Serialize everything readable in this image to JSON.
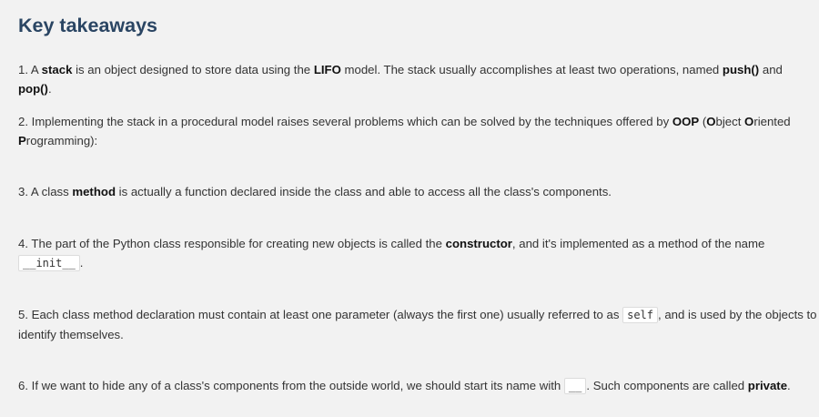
{
  "title": "Key takeaways",
  "items": [
    {
      "num": "1. A ",
      "b1": "stack",
      "t1": " is an object designed to store data using the ",
      "b2": "LIFO",
      "t2": " model. The stack usually accomplishes at least two operations, named ",
      "b3": "push()",
      "t3": " and ",
      "b4": "pop()",
      "t4": "."
    },
    {
      "t1": "2. Implementing the stack in a procedural model raises several problems which can be solved by the techniques offered by ",
      "b1": "OOP",
      "t2": " (",
      "b2": "O",
      "t3": "bject ",
      "b3": "O",
      "t4": "riented ",
      "b4": "P",
      "t5": "rogramming):"
    },
    {
      "t1": "3. A class ",
      "b1": "method",
      "t2": " is actually a function declared inside the class and able to access all the class's components."
    },
    {
      "t1": "4. The part of the Python class responsible for creating new objects is called the ",
      "b1": "constructor",
      "t2": ", and it's implemented as a method of the name ",
      "code": "__init__",
      "t3": "."
    },
    {
      "t1": "5. Each class method declaration must contain at least one parameter (always the first one) usually referred to as ",
      "code": "self",
      "t2": ", and is used by the objects to identify themselves."
    },
    {
      "t1": "6. If we want to hide any of a class's components from the outside world, we should start its name with ",
      "code": "__",
      "t2": ". Such components are called ",
      "b1": "private",
      "t3": "."
    }
  ]
}
